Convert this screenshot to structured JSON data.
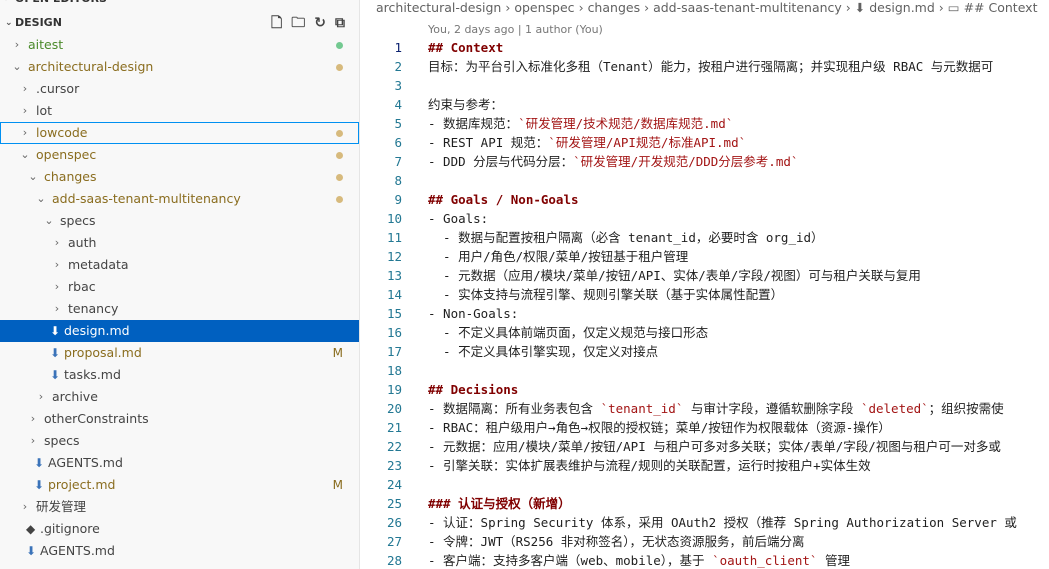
{
  "sidebar": {
    "open_editors": "OPEN EDITORS",
    "section": "DESIGN",
    "rows": [
      {
        "label": "aitest",
        "depth": 0,
        "caret": "›",
        "icon": "",
        "status": "dot",
        "color": "#73c991",
        "labelColor": "#4a8a2a"
      },
      {
        "label": "architectural-design",
        "depth": 0,
        "caret": "⌄",
        "icon": "",
        "status": "dot",
        "color": "#d7ba7d",
        "labelColor": "#8a6d1f"
      },
      {
        "label": ".cursor",
        "depth": 1,
        "caret": "›",
        "icon": "",
        "status": "",
        "color": "",
        "labelColor": "#444"
      },
      {
        "label": "lot",
        "depth": 1,
        "caret": "›",
        "icon": "",
        "status": "",
        "color": "",
        "labelColor": "#444"
      },
      {
        "label": "lowcode",
        "depth": 1,
        "caret": "›",
        "icon": "",
        "status": "dot",
        "color": "#d7ba7d",
        "labelColor": "#8a6d1f",
        "focus": true
      },
      {
        "label": "openspec",
        "depth": 1,
        "caret": "⌄",
        "icon": "",
        "status": "dot",
        "color": "#d7ba7d",
        "labelColor": "#8a6d1f"
      },
      {
        "label": "changes",
        "depth": 2,
        "caret": "⌄",
        "icon": "",
        "status": "dot",
        "color": "#d7ba7d",
        "labelColor": "#8a6d1f"
      },
      {
        "label": "add-saas-tenant-multitenancy",
        "depth": 3,
        "caret": "⌄",
        "icon": "",
        "status": "dot",
        "color": "#d7ba7d",
        "labelColor": "#8a6d1f"
      },
      {
        "label": "specs",
        "depth": 4,
        "caret": "⌄",
        "icon": "",
        "status": "",
        "color": "",
        "labelColor": "#444"
      },
      {
        "label": "auth",
        "depth": 5,
        "caret": "›",
        "icon": "",
        "status": "",
        "color": "",
        "labelColor": "#444"
      },
      {
        "label": "metadata",
        "depth": 5,
        "caret": "›",
        "icon": "",
        "status": "",
        "color": "",
        "labelColor": "#444"
      },
      {
        "label": "rbac",
        "depth": 5,
        "caret": "›",
        "icon": "",
        "status": "",
        "color": "",
        "labelColor": "#444"
      },
      {
        "label": "tenancy",
        "depth": 5,
        "caret": "›",
        "icon": "",
        "status": "",
        "color": "",
        "labelColor": "#444"
      },
      {
        "label": "design.md",
        "depth": 4,
        "caret": "",
        "icon": "⬇",
        "status": "",
        "color": "",
        "labelColor": "#ffffff",
        "selected": true
      },
      {
        "label": "proposal.md",
        "depth": 4,
        "caret": "",
        "icon": "⬇",
        "status": "M",
        "color": "#8a6d1f",
        "labelColor": "#8a6d1f"
      },
      {
        "label": "tasks.md",
        "depth": 4,
        "caret": "",
        "icon": "⬇",
        "status": "",
        "color": "",
        "labelColor": "#444"
      },
      {
        "label": "archive",
        "depth": 3,
        "caret": "›",
        "icon": "",
        "status": "",
        "color": "",
        "labelColor": "#444"
      },
      {
        "label": "otherConstraints",
        "depth": 2,
        "caret": "›",
        "icon": "",
        "status": "",
        "color": "",
        "labelColor": "#444"
      },
      {
        "label": "specs",
        "depth": 2,
        "caret": "›",
        "icon": "",
        "status": "",
        "color": "",
        "labelColor": "#444"
      },
      {
        "label": "AGENTS.md",
        "depth": 2,
        "caret": "",
        "icon": "⬇",
        "status": "",
        "color": "",
        "labelColor": "#444"
      },
      {
        "label": "project.md",
        "depth": 2,
        "caret": "",
        "icon": "⬇",
        "status": "M",
        "color": "#8a6d1f",
        "labelColor": "#8a6d1f"
      },
      {
        "label": "研发管理",
        "depth": 1,
        "caret": "›",
        "icon": "",
        "status": "",
        "color": "",
        "labelColor": "#444"
      },
      {
        "label": ".gitignore",
        "depth": 1,
        "caret": "",
        "icon": "◆",
        "status": "",
        "color": "",
        "labelColor": "#444"
      },
      {
        "label": "AGENTS.md",
        "depth": 1,
        "caret": "",
        "icon": "⬇",
        "status": "",
        "color": "",
        "labelColor": "#444"
      }
    ]
  },
  "breadcrumb": [
    "architectural-design",
    "›",
    "openspec",
    "›",
    "changes",
    "›",
    "add-saas-tenant-multitenancy",
    "›",
    "⬇ design.md",
    "›",
    "▭ ## Context"
  ],
  "blame": "You, 2 days ago | 1 author (You)",
  "lines": [
    {
      "n": "1",
      "parts": [
        {
          "t": "## Context",
          "c": "hd"
        }
      ]
    },
    {
      "n": "2",
      "parts": [
        {
          "t": "目标：为平台引入标准化多租（Tenant）能力，按租户进行强隔离；并实现租户级 RBAC 与元数据可",
          "c": ""
        }
      ]
    },
    {
      "n": "3",
      "parts": []
    },
    {
      "n": "4",
      "parts": [
        {
          "t": "约束与参考：",
          "c": ""
        }
      ]
    },
    {
      "n": "5",
      "parts": [
        {
          "t": "- 数据库规范：",
          "c": ""
        },
        {
          "t": "`研发管理/技术规范/数据库规范.md`",
          "c": "str"
        }
      ]
    },
    {
      "n": "6",
      "parts": [
        {
          "t": "- REST API 规范：",
          "c": ""
        },
        {
          "t": "`研发管理/API规范/标准API.md`",
          "c": "str"
        }
      ]
    },
    {
      "n": "7",
      "parts": [
        {
          "t": "- DDD 分层与代码分层：",
          "c": ""
        },
        {
          "t": "`研发管理/开发规范/DDD分层参考.md`",
          "c": "str"
        }
      ]
    },
    {
      "n": "8",
      "parts": []
    },
    {
      "n": "9",
      "parts": [
        {
          "t": "## Goals / Non-Goals",
          "c": "hd"
        }
      ]
    },
    {
      "n": "10",
      "parts": [
        {
          "t": "- Goals:",
          "c": ""
        }
      ]
    },
    {
      "n": "11",
      "parts": [
        {
          "t": "  - 数据与配置按租户隔离（必含 tenant_id，必要时含 org_id）",
          "c": ""
        }
      ]
    },
    {
      "n": "12",
      "parts": [
        {
          "t": "  - 用户/角色/权限/菜单/按钮基于租户管理",
          "c": ""
        }
      ]
    },
    {
      "n": "13",
      "parts": [
        {
          "t": "  - 元数据（应用/模块/菜单/按钮/API、实体/表单/字段/视图）可与租户关联与复用",
          "c": ""
        }
      ]
    },
    {
      "n": "14",
      "parts": [
        {
          "t": "  - 实体支持与流程引擎、规则引擎关联（基于实体属性配置）",
          "c": ""
        }
      ]
    },
    {
      "n": "15",
      "parts": [
        {
          "t": "- Non-Goals:",
          "c": ""
        }
      ]
    },
    {
      "n": "16",
      "parts": [
        {
          "t": "  - 不定义具体前端页面，仅定义规范与接口形态",
          "c": ""
        }
      ]
    },
    {
      "n": "17",
      "parts": [
        {
          "t": "  - 不定义具体引擎实现，仅定义对接点",
          "c": ""
        }
      ]
    },
    {
      "n": "18",
      "parts": []
    },
    {
      "n": "19",
      "parts": [
        {
          "t": "## Decisions",
          "c": "hd"
        }
      ]
    },
    {
      "n": "20",
      "parts": [
        {
          "t": "- 数据隔离：所有业务表包含 ",
          "c": ""
        },
        {
          "t": "`tenant_id`",
          "c": "str"
        },
        {
          "t": " 与审计字段，遵循软删除字段 ",
          "c": ""
        },
        {
          "t": "`deleted`",
          "c": "str"
        },
        {
          "t": "；组织按需使",
          "c": ""
        }
      ]
    },
    {
      "n": "21",
      "parts": [
        {
          "t": "- RBAC：租户级用户→角色→权限的授权链；菜单/按钮作为权限载体（资源-操作）",
          "c": ""
        }
      ]
    },
    {
      "n": "22",
      "parts": [
        {
          "t": "- 元数据：应用/模块/菜单/按钮/API 与租户可多对多关联；实体/表单/字段/视图与租户可一对多或",
          "c": ""
        }
      ]
    },
    {
      "n": "23",
      "parts": [
        {
          "t": "- 引擎关联：实体扩展表维护与流程/规则的关联配置，运行时按租户+实体生效",
          "c": ""
        }
      ]
    },
    {
      "n": "24",
      "parts": []
    },
    {
      "n": "25",
      "parts": [
        {
          "t": "### 认证与授权（新增）",
          "c": "hd"
        }
      ]
    },
    {
      "n": "26",
      "parts": [
        {
          "t": "- 认证：Spring Security 体系，采用 OAuth2 授权（推荐 Spring Authorization Server 或",
          "c": ""
        }
      ]
    },
    {
      "n": "27",
      "parts": [
        {
          "t": "- 令牌：JWT（RS256 非对称签名），无状态资源服务，前后端分离",
          "c": ""
        }
      ]
    },
    {
      "n": "28",
      "parts": [
        {
          "t": "- 客户端：支持多客户端（web、mobile），基于 ",
          "c": ""
        },
        {
          "t": "`oauth_client`",
          "c": "str"
        },
        {
          "t": " 管理",
          "c": ""
        }
      ]
    }
  ]
}
